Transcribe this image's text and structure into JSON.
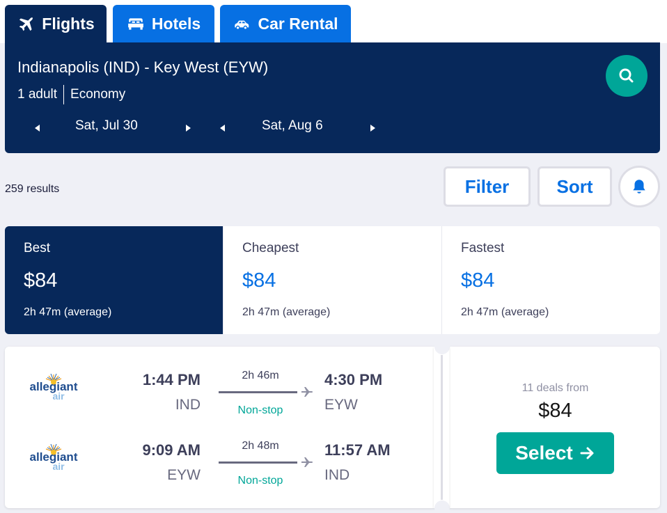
{
  "tabs": [
    {
      "label": "Flights",
      "icon": "plane-icon",
      "active": true
    },
    {
      "label": "Hotels",
      "icon": "bed-icon",
      "active": false
    },
    {
      "label": "Car Rental",
      "icon": "car-icon",
      "active": false
    }
  ],
  "search": {
    "route": "Indianapolis (IND) - Key West (EYW)",
    "travelers": "1 adult",
    "cabin": "Economy",
    "depart_date": "Sat, Jul 30",
    "return_date": "Sat, Aug 6",
    "search_icon": "search-icon"
  },
  "results": {
    "count": "259 results",
    "filter_label": "Filter",
    "sort_label": "Sort",
    "alert_icon": "bell-icon"
  },
  "sort_tabs": [
    {
      "label": "Best",
      "price": "$84",
      "duration": "2h 47m (average)",
      "active": true
    },
    {
      "label": "Cheapest",
      "price": "$84",
      "duration": "2h 47m (average)",
      "active": false
    },
    {
      "label": "Fastest",
      "price": "$84",
      "duration": "2h 47m (average)",
      "active": false
    }
  ],
  "itinerary": {
    "legs": [
      {
        "airline": "allegiant air",
        "depart_time": "1:44 PM",
        "depart_code": "IND",
        "duration": "2h 46m",
        "stops": "Non-stop",
        "arrive_time": "4:30 PM",
        "arrive_code": "EYW"
      },
      {
        "airline": "allegiant air",
        "depart_time": "9:09 AM",
        "depart_code": "EYW",
        "duration": "2h 48m",
        "stops": "Non-stop",
        "arrive_time": "11:57 AM",
        "arrive_code": "IND"
      }
    ],
    "deals_text": "11 deals from",
    "price": "$84",
    "select_label": "Select"
  },
  "colors": {
    "navy": "#07285a",
    "blue": "#0770e3",
    "teal": "#00a698",
    "background": "#eff0f6"
  }
}
